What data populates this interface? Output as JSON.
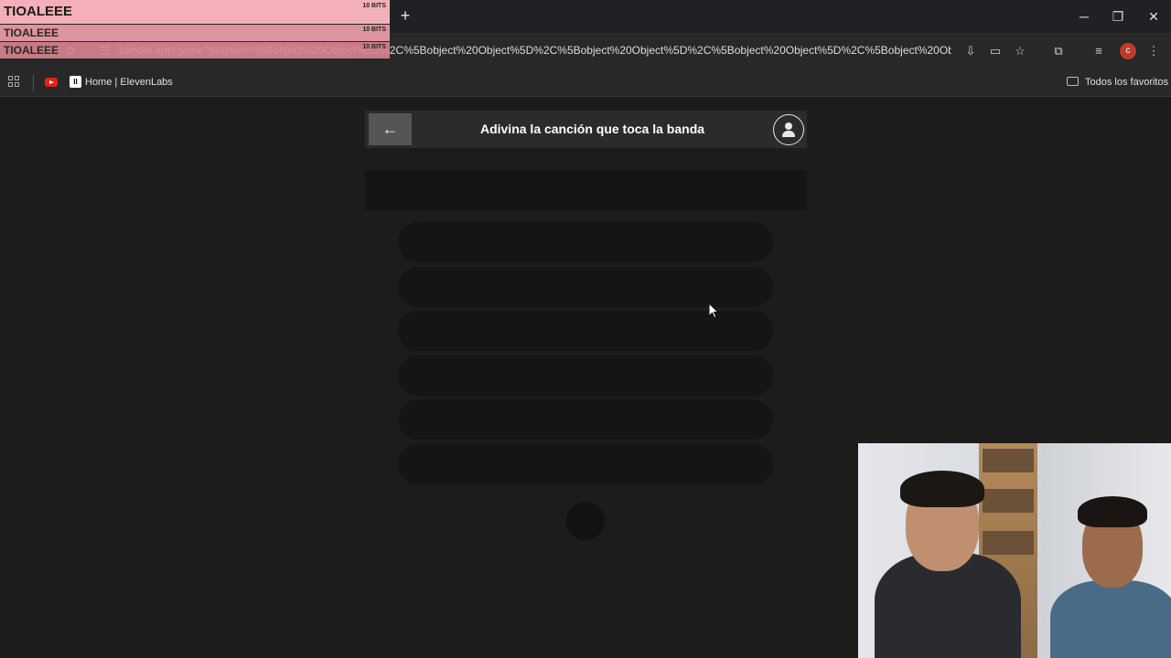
{
  "stream_overlay": {
    "entries": [
      {
        "name": "TIOALEEE",
        "bits": "10 BITS"
      },
      {
        "name": "TIOALEEE",
        "bits": "10 BITS"
      },
      {
        "name": "TIOALEEE",
        "bits": "10 BITS"
      }
    ]
  },
  "browser": {
    "new_tab_symbol": "+",
    "window_controls": {
      "minimize": "─",
      "restore": "❐",
      "close": "✕"
    },
    "url": "bandle.app/game?playlist=%5Bobject%20Object%5D%2C%5Bobject%20Object%5D%2C%5Bobject%20Object%5D%2C%5Bobject%20Object%5D%2C%5Bobject%20Object%5...",
    "profile_initial": "c",
    "bookmarks": [
      {
        "label": "Home | ElevenLabs"
      }
    ],
    "all_bookmarks_label": "Todos los favoritos"
  },
  "game": {
    "title": "Adivina la canción que toca la banda",
    "back_symbol": "🡐"
  }
}
